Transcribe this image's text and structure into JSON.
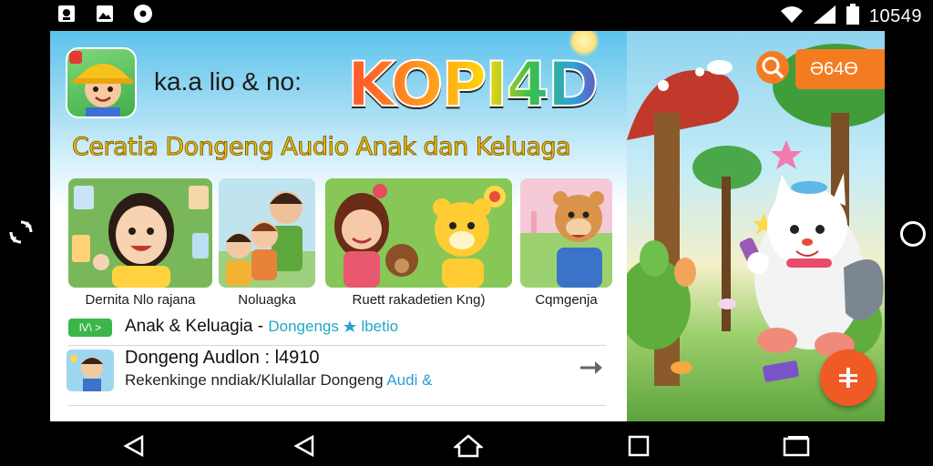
{
  "status_bar": {
    "clock": "10549",
    "left_icons": [
      "image-icon",
      "gallery-icon",
      "disc-icon"
    ],
    "right_icons": [
      "wifi-icon",
      "signal-icon",
      "battery-icon"
    ]
  },
  "header": {
    "tagline": "ka.a lio & no:",
    "brand": "KOPI4D",
    "subtitle": "Ceratia Dongeng Audio Anak dan Keluaga"
  },
  "cards": [
    {
      "label": "Dernita Nlo rajana"
    },
    {
      "label": "Noluagka"
    },
    {
      "label": "Ruett rakadetien Kng)"
    },
    {
      "label": "Cqmgenja"
    }
  ],
  "list": {
    "row1": {
      "pill": "lV\\ >",
      "title": "Anak & Keluagia -",
      "link": "Dongengs",
      "suffix": "lbetio"
    },
    "row2": {
      "title": "Dongeng Audlon : l4910",
      "desc": "Rekenkinge nndiak/Klulallar Dongeng",
      "desc_blue": "Audi &"
    }
  },
  "right_panel": {
    "code": "Ә64Ө"
  },
  "colors": {
    "accent": "#f47c20",
    "brand_yellow": "#f2c40f",
    "pill_green": "#3cb64a",
    "link_blue": "#22a7c7"
  }
}
